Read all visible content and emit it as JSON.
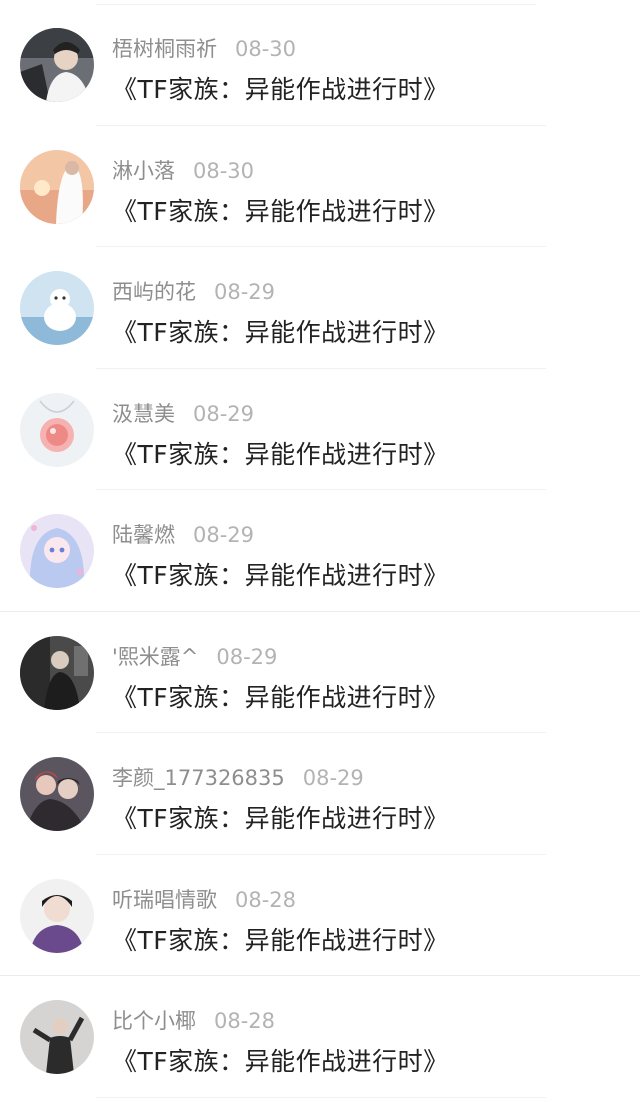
{
  "messages": [
    {
      "name": "梧树桐雨祈",
      "date": "08-30",
      "title": "《TF家族：异能作战进行时》",
      "avatar_icon": "avatar-person-car-icon"
    },
    {
      "name": "淋小落",
      "date": "08-30",
      "title": "《TF家族：异能作战进行时》",
      "avatar_icon": "avatar-sunset-girl-icon"
    },
    {
      "name": "西屿的花",
      "date": "08-29",
      "title": "《TF家族：异能作战进行时》",
      "avatar_icon": "avatar-blue-creature-icon"
    },
    {
      "name": "汲慧美",
      "date": "08-29",
      "title": "《TF家族：异能作战进行时》",
      "avatar_icon": "avatar-pink-pendant-icon"
    },
    {
      "name": "陆馨燃",
      "date": "08-29",
      "title": "《TF家族：异能作战进行时》",
      "avatar_icon": "avatar-anime-girl-icon"
    },
    {
      "name": "'熙米露^",
      "date": "08-29",
      "title": "《TF家族：异能作战进行时》",
      "avatar_icon": "avatar-dark-photo-icon"
    },
    {
      "name": "李颜_177326835",
      "date": "08-29",
      "title": "《TF家族：异能作战进行时》",
      "avatar_icon": "avatar-two-people-icon"
    },
    {
      "name": "听瑞唱情歌",
      "date": "08-28",
      "title": "《TF家族：异能作战进行时》",
      "avatar_icon": "avatar-boy-portrait-icon"
    },
    {
      "name": "比个小椰",
      "date": "08-28",
      "title": "《TF家族：异能作战进行时》",
      "avatar_icon": "avatar-boy-pose-icon"
    }
  ]
}
